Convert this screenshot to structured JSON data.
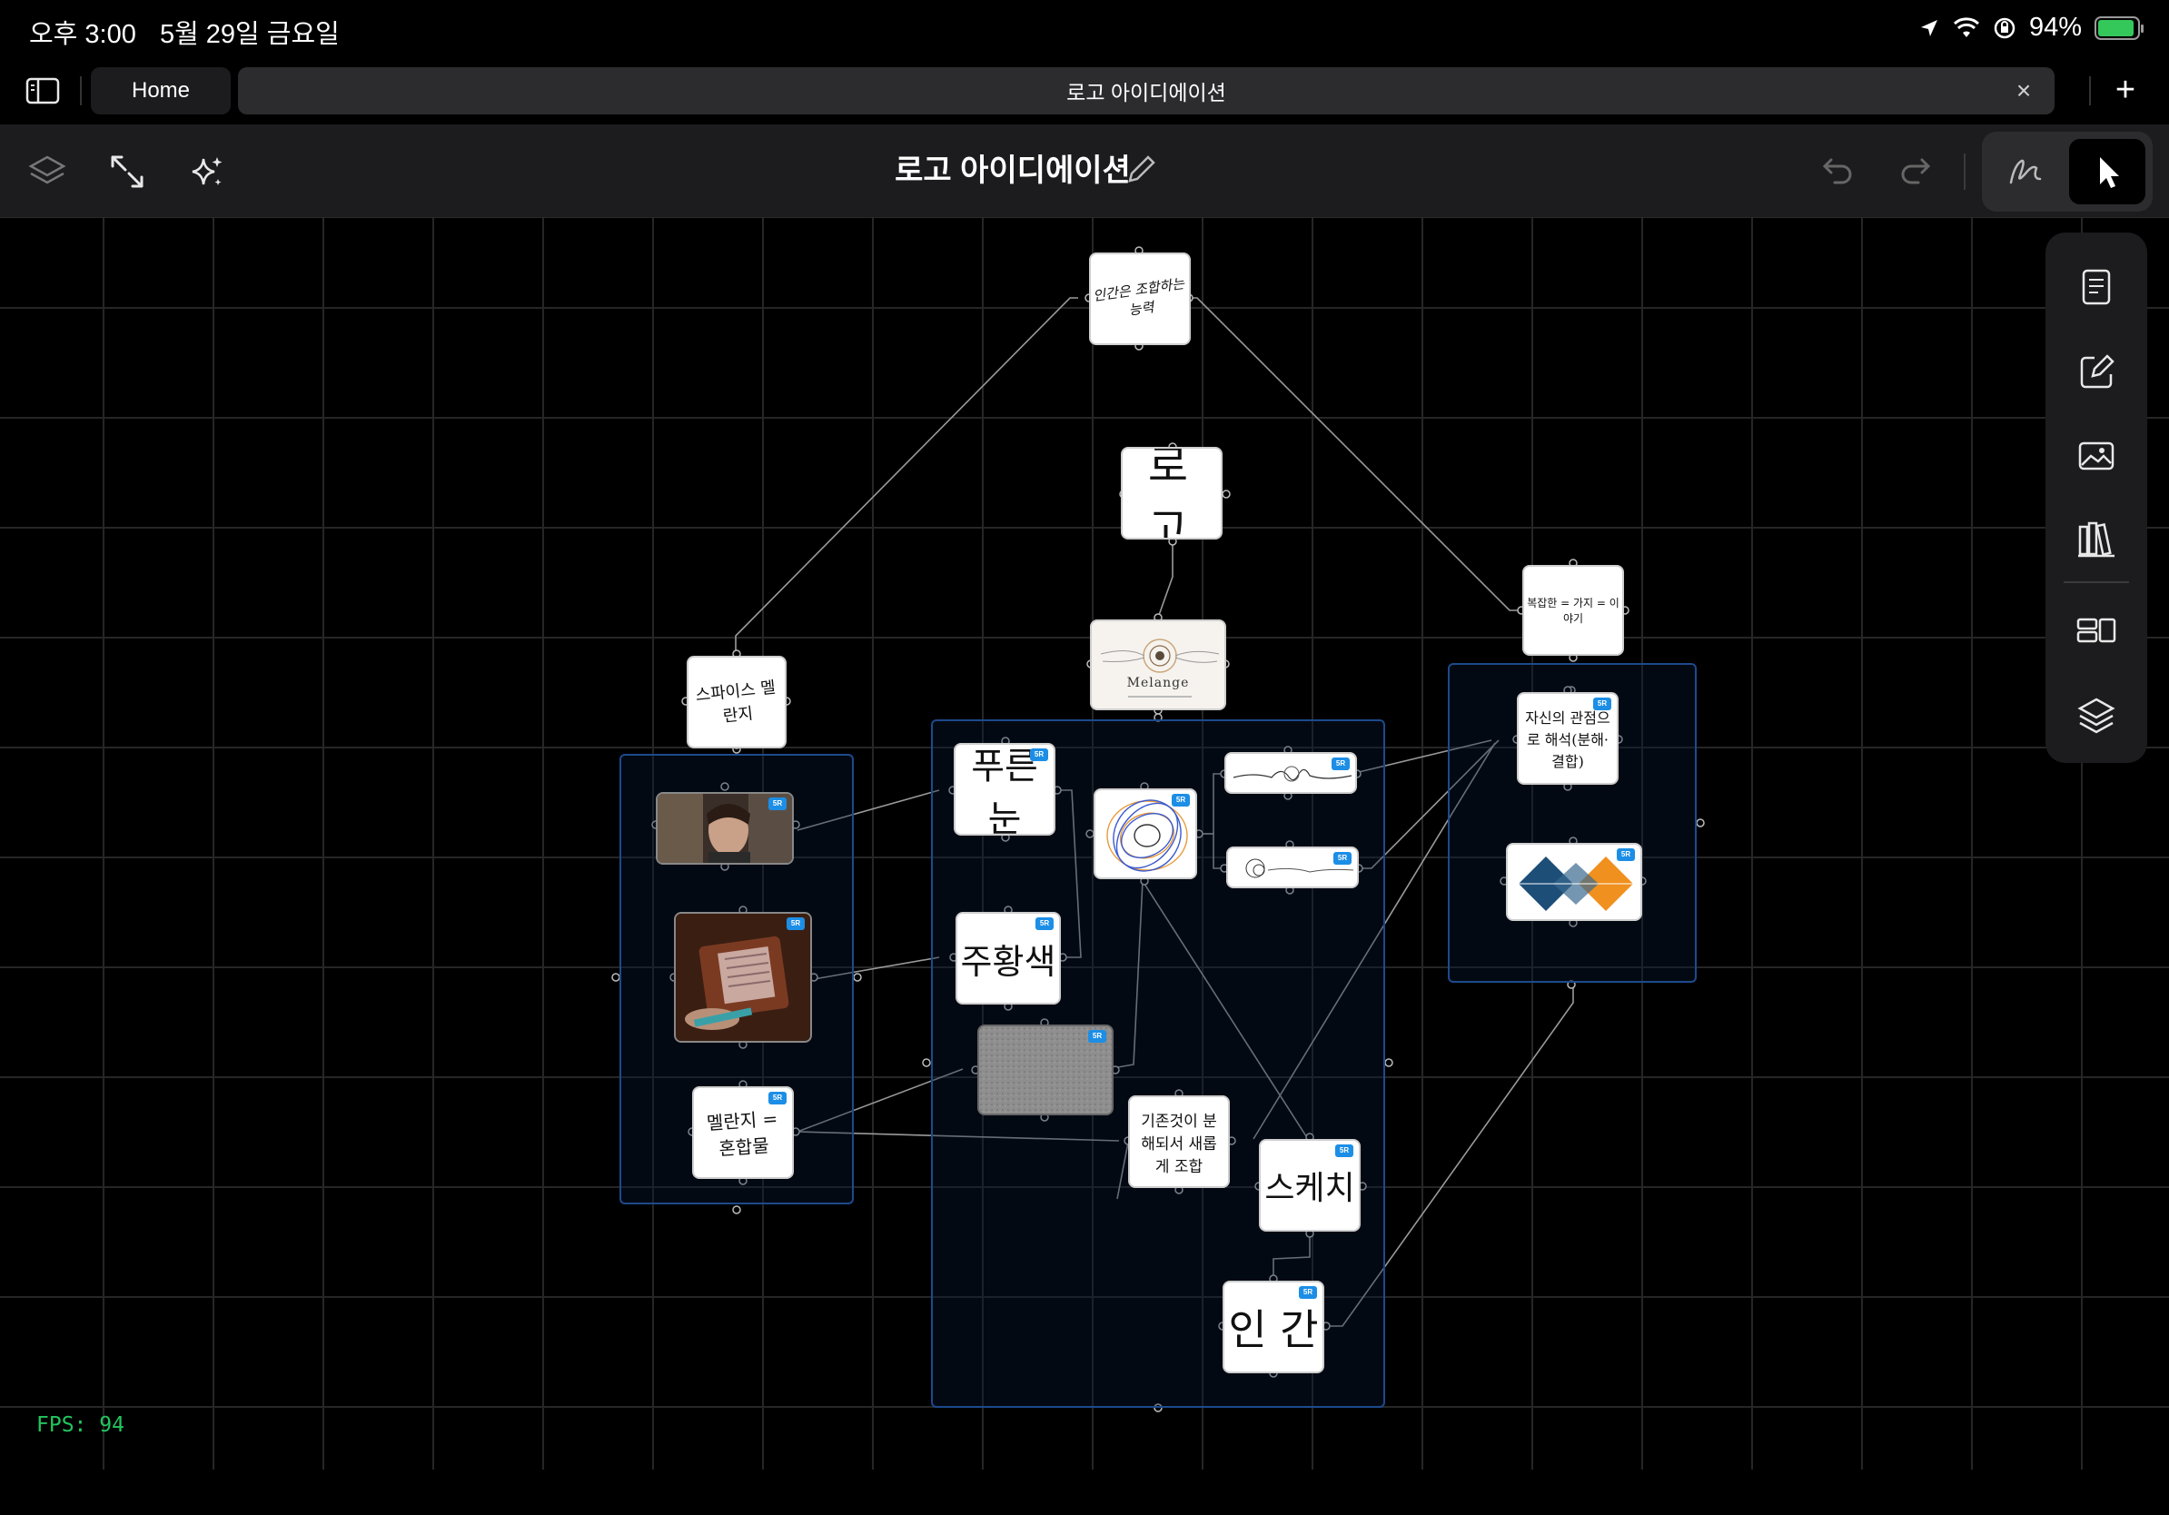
{
  "status_bar": {
    "time": "오후 3:00",
    "date": "5월 29일 금요일",
    "battery_percent": "94%",
    "battery_level": 0.94,
    "icons": [
      "location-arrow-icon",
      "wifi-icon",
      "orientation-lock-icon",
      "battery-charging-icon"
    ]
  },
  "tabs": {
    "home_label": "Home",
    "active_label": "로고 아이디에이션",
    "close_glyph": "×",
    "add_glyph": "+"
  },
  "toolbar": {
    "title": "로고 아이디에이션",
    "icons": [
      "layers-icon",
      "expand-icon",
      "sparkle-icon",
      "pencil-edit-icon",
      "undo-icon",
      "redo-icon",
      "pen-tool-icon",
      "pointer-icon"
    ]
  },
  "canvas": {
    "cards": {
      "top_note": "인간은 조합하는 능력",
      "logo": "로 고",
      "melange_label": "Melange",
      "right_top_note": "복잡한 = 가지 = 이야기",
      "right_note2": "자신의 관점으로 해석(분해·결합)",
      "spice_note": "스파이스 멜란지",
      "blue_eyes": "푸른 눈",
      "orange": "주황색",
      "melange_mix": "멜란지 = 혼합물",
      "combine_note": "기존것이 분해되서 새롭게 조합",
      "sketch": "스케치",
      "human": "인 간"
    },
    "badge_text": "5R"
  },
  "side_panel": {
    "icons": [
      "note-icon",
      "edit-square-icon",
      "image-icon",
      "library-icon",
      "layout-icon",
      "stack-icon"
    ]
  },
  "fps_label": "FPS: 94",
  "colors": {
    "accent_blue": "#1c8ee6",
    "group_border": "#1d4a8c",
    "fps_green": "#22c55e",
    "battery_green": "#34c759"
  }
}
